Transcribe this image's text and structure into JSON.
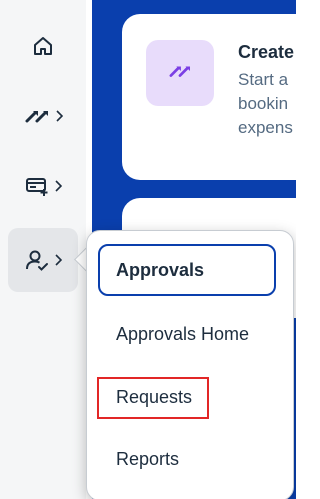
{
  "sidebar": {
    "items": [
      {
        "icon": "home-icon"
      },
      {
        "icon": "travel-arrows-icon",
        "chevron": "›"
      },
      {
        "icon": "expense-card-icon",
        "chevron": "›"
      },
      {
        "icon": "approvals-person-icon",
        "chevron": "›"
      }
    ]
  },
  "card": {
    "title": "Create",
    "description_lines": [
      "Start a",
      "bookin",
      "expens"
    ]
  },
  "menu": {
    "header": "Approvals",
    "items": [
      "Approvals Home",
      "Requests",
      "Reports"
    ]
  },
  "colors": {
    "brand_blue": "#0a3fad",
    "text": "#1d2d3e",
    "highlight_red": "#e22626",
    "icon_purple_bg": "#e8dcfb"
  }
}
